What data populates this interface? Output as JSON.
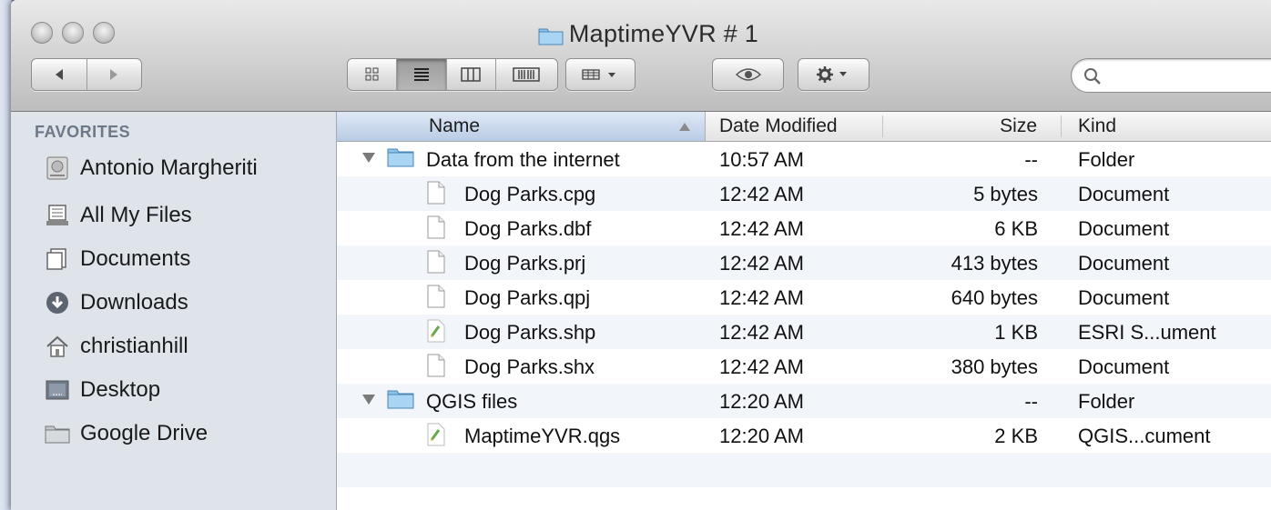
{
  "window": {
    "title": "MaptimeYVR # 1"
  },
  "toolbar": {
    "nav": {
      "back_icon": "back-arrow-icon",
      "forward_icon": "forward-arrow-icon"
    },
    "view_modes": [
      "icon-view",
      "list-view",
      "column-view",
      "cover-flow-view"
    ],
    "active_view": "list-view",
    "arrange_icon": "arrange-menu-icon",
    "quicklook_icon": "eye-icon",
    "action_icon": "gear-icon",
    "search": {
      "value": "",
      "placeholder": ""
    }
  },
  "sidebar": {
    "heading": "FAVORITES",
    "items": [
      {
        "label": "Antonio Margheriti",
        "icon": "hard-drive-icon"
      },
      {
        "label": "All My Files",
        "icon": "all-files-icon"
      },
      {
        "label": "Documents",
        "icon": "documents-icon"
      },
      {
        "label": "Downloads",
        "icon": "downloads-icon"
      },
      {
        "label": "christianhill",
        "icon": "home-icon"
      },
      {
        "label": "Desktop",
        "icon": "desktop-icon"
      },
      {
        "label": "Google Drive",
        "icon": "folder-icon"
      }
    ]
  },
  "columns": {
    "name": "Name",
    "date": "Date Modified",
    "size": "Size",
    "kind": "Kind"
  },
  "files": [
    {
      "name": "Data from the internet",
      "date": "10:57 AM",
      "size": "--",
      "kind": "Folder",
      "type": "folder"
    },
    {
      "name": "Dog Parks.cpg",
      "date": "12:42 AM",
      "size": "5 bytes",
      "kind": "Document",
      "type": "doc"
    },
    {
      "name": "Dog Parks.dbf",
      "date": "12:42 AM",
      "size": "6 KB",
      "kind": "Document",
      "type": "doc"
    },
    {
      "name": "Dog Parks.prj",
      "date": "12:42 AM",
      "size": "413 bytes",
      "kind": "Document",
      "type": "doc"
    },
    {
      "name": "Dog Parks.qpj",
      "date": "12:42 AM",
      "size": "640 bytes",
      "kind": "Document",
      "type": "doc"
    },
    {
      "name": "Dog Parks.shp",
      "date": "12:42 AM",
      "size": "1 KB",
      "kind": "ESRI S...ument",
      "type": "gis"
    },
    {
      "name": "Dog Parks.shx",
      "date": "12:42 AM",
      "size": "380 bytes",
      "kind": "Document",
      "type": "doc"
    },
    {
      "name": "QGIS files",
      "date": "12:20 AM",
      "size": "--",
      "kind": "Folder",
      "type": "folder"
    },
    {
      "name": "MaptimeYVR.qgs",
      "date": "12:20 AM",
      "size": "2 KB",
      "kind": "QGIS...cument",
      "type": "gis"
    }
  ]
}
